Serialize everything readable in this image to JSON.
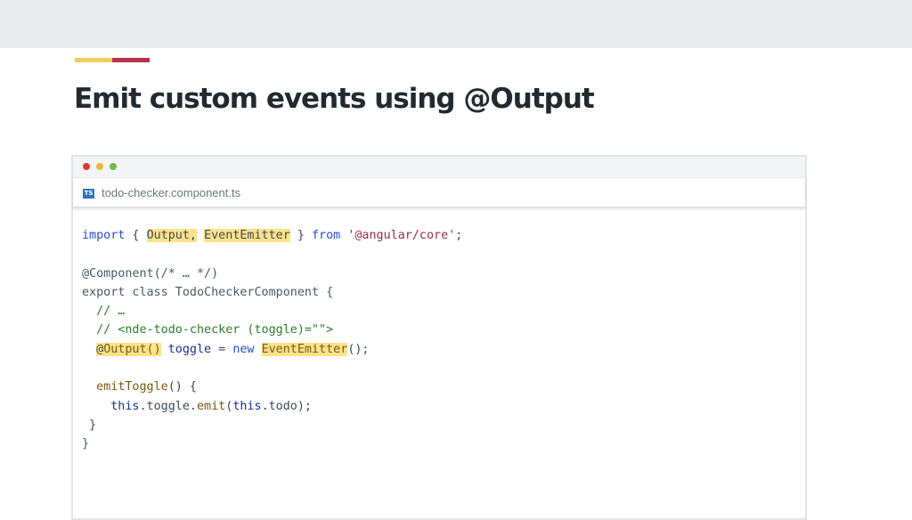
{
  "slide": {
    "title": "Emit custom events using @Output"
  },
  "editor": {
    "file_icon_label": "TS",
    "tab_filename": "todo-checker.component.ts",
    "code": {
      "l1": {
        "t1": "import",
        "t2": " { ",
        "t3": "Output,",
        "t4": " ",
        "t5": "EventEmitter",
        "t6": " } ",
        "t7": "from",
        "t8": " ",
        "t9": "'@angular/core'",
        "t10": ";"
      },
      "l3": {
        "t1": "@Component(/* … */)"
      },
      "l4": {
        "t1": "export class TodoCheckerComponent {"
      },
      "l5": {
        "t1": "  // …"
      },
      "l6": {
        "t1": "  // <nde-todo-checker (toggle)=\"\">"
      },
      "l7": {
        "t0": "  ",
        "t1": "@",
        "t2": "Output()",
        "t3": " ",
        "t4": "toggle",
        "t5": " = ",
        "t6": "new",
        "t7": " ",
        "t8": "EventEmitter",
        "t9": "();"
      },
      "l9": {
        "t0": "  ",
        "t1": "emitToggle",
        "t2": "() {"
      },
      "l10": {
        "t0": "    ",
        "t1": "this",
        "t2": ".toggle.",
        "t3": "emit",
        "t4": "(",
        "t5": "this",
        "t6": ".todo);"
      },
      "l11": {
        "t1": " }"
      },
      "l12": {
        "t1": "}"
      }
    }
  },
  "colors": {
    "topbar": "#e9ebec",
    "accent_yellow": "#f3cd5a",
    "accent_red": "#b8334b",
    "highlight": "#fce28b",
    "ts_icon": "#2f74c0"
  }
}
